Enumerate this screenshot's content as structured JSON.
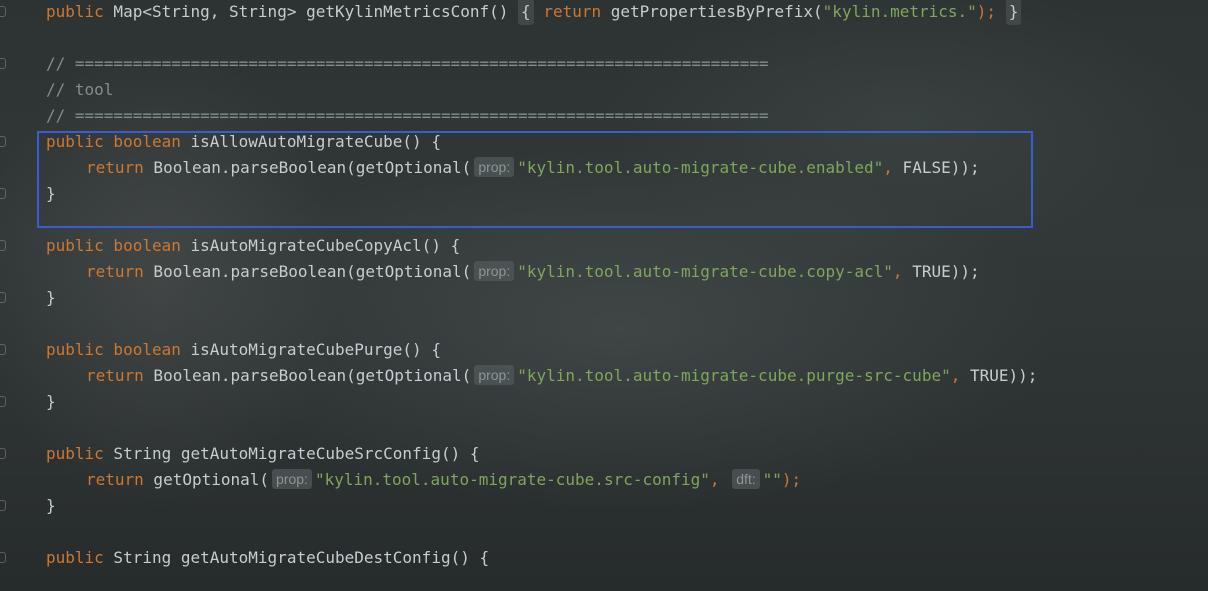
{
  "code": {
    "line1": {
      "kw": "public",
      "type": " Map<String, String> ",
      "method": "getKylinMetricsConf",
      "open": "() ",
      "brace_open": "{",
      "ret": "return",
      "call": " getPropertiesByPrefix(",
      "arg": "\"kylin.metrics.\"",
      "end": "); ",
      "brace_close": "}"
    },
    "sep1": "// ========================================================================",
    "tool_comment": "// tool",
    "sep2": "// ========================================================================",
    "m1": {
      "sig_kw": "public boolean",
      "sig_name": " isAllowAutoMigrateCube() {",
      "ret": "return",
      "call": " Boolean.parseBoolean(getOptional(",
      "hint": "prop:",
      "arg": "\"kylin.tool.auto-migrate-cube.enabled\"",
      "comma": ",",
      "rest": " FALSE));",
      "close": "}"
    },
    "m2": {
      "sig_kw": "public boolean",
      "sig_name": " isAutoMigrateCubeCopyAcl() {",
      "ret": "return",
      "call": " Boolean.parseBoolean(getOptional(",
      "hint": "prop:",
      "arg": "\"kylin.tool.auto-migrate-cube.copy-acl\"",
      "comma": ",",
      "rest": " TRUE));",
      "close": "}"
    },
    "m3": {
      "sig_kw": "public boolean",
      "sig_name": " isAutoMigrateCubePurge() {",
      "ret": "return",
      "call": " Boolean.parseBoolean(getOptional(",
      "hint": "prop:",
      "arg": "\"kylin.tool.auto-migrate-cube.purge-src-cube\"",
      "comma": ",",
      "rest": " TRUE));",
      "close": "}"
    },
    "m4": {
      "sig_kw": "public",
      "sig_name": " String getAutoMigrateCubeSrcConfig() {",
      "ret": "return",
      "call": " getOptional(",
      "hint": "prop:",
      "arg": "\"kylin.tool.auto-migrate-cube.src-config\"",
      "comma": ",",
      "hint2": "dft:",
      "arg2": "\"\"",
      "rest": ");",
      "close": "}"
    },
    "m5": {
      "sig_kw": "public",
      "sig_name": " String getAutoMigrateCubeDestConfig() {"
    }
  },
  "colors": {
    "keyword": "#cc7832",
    "string": "#7fa65a",
    "comment": "#808d8f",
    "highlight_border": "#3a5bd6"
  }
}
